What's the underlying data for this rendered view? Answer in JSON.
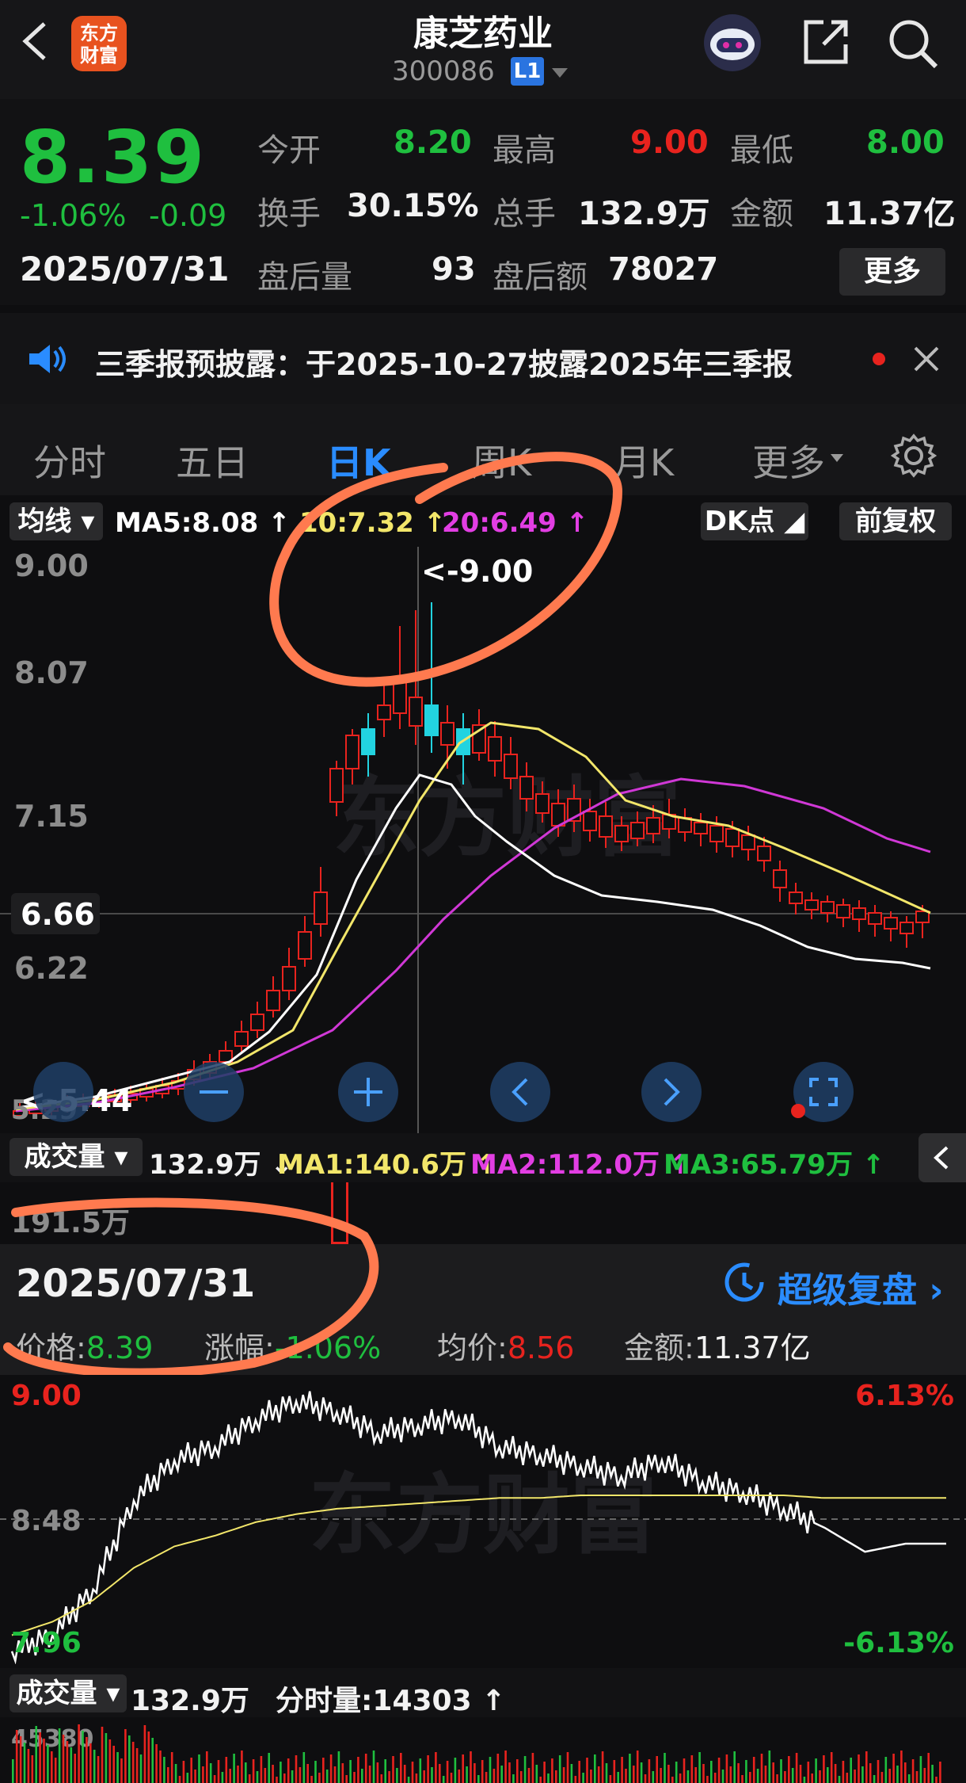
{
  "header": {
    "title": "康芝药业",
    "code": "300086",
    "level_badge": "L1",
    "logo_text": "东方财富",
    "icons": [
      "back-icon",
      "robot-icon",
      "share-icon",
      "search-icon"
    ]
  },
  "quote": {
    "price": "8.39",
    "change_pct": "-1.06%",
    "change": "-0.09",
    "date": "2025/07/31",
    "fields": {
      "open_label": "今开",
      "open": "8.20",
      "high_label": "最高",
      "high": "9.00",
      "low_label": "最低",
      "low": "8.00",
      "turnover_label": "换手",
      "turnover": "30.15%",
      "volume_label": "总手",
      "volume": "132.9万",
      "amount_label": "金额",
      "amount": "11.37亿",
      "after_vol_label": "盘后量",
      "after_vol": "93",
      "after_amt_label": "盘后额",
      "after_amt": "78027"
    },
    "more_button": "更多"
  },
  "notice": {
    "text": "三季报预披露：于2025-10-27披露2025年三季报"
  },
  "tabs": [
    {
      "label": "分时",
      "active": false
    },
    {
      "label": "五日",
      "active": false
    },
    {
      "label": "日K",
      "active": true
    },
    {
      "label": "周K",
      "active": false
    },
    {
      "label": "月K",
      "active": false
    },
    {
      "label": "更多",
      "active": false
    }
  ],
  "kline_bar": {
    "ma_selector": "均线",
    "ma5": "MA5:8.08",
    "ma10": "10:7.32",
    "ma20": "20:6.49",
    "dk_button": "DK点",
    "adjust_button": "前复权",
    "colors": {
      "ma5": "#ffffff",
      "ma10": "#f2e66a",
      "ma20": "#e23ee3",
      "up": "#e8231e",
      "down": "#22d3e0"
    }
  },
  "kline_axis": {
    "labels": [
      "9.00",
      "8.07",
      "7.15",
      "6.66",
      "6.22"
    ],
    "high_marker": "<-9.00",
    "low_marker": "<-5.44",
    "partial_low": "5.29"
  },
  "volume_bar": {
    "selector": "成交量",
    "value": "132.9万",
    "ma1": "MA1:140.6万",
    "ma2": "MA2:112.0万",
    "ma3": "MA3:65.79万",
    "axis_label": "191.5万"
  },
  "day_detail": {
    "date": "2025/07/31",
    "replay_label": "超级复盘",
    "price_label": "价格:",
    "price": "8.39",
    "change_label": "涨幅:",
    "change": "-1.06%",
    "avg_label": "均价:",
    "avg": "8.56",
    "amount_label": "金额:",
    "amount": "11.37亿"
  },
  "intraday": {
    "top_price": "9.00",
    "mid_price": "8.48",
    "bottom_price": "7.96",
    "top_pct": "6.13%",
    "bottom_pct": "-6.13%",
    "volume_selector": "成交量",
    "volume_value": "132.9万",
    "minute_volume": "分时量:14303",
    "vol_axis": "45380"
  },
  "watermark": "东方财富",
  "chart_data": {
    "type": "line",
    "title": "",
    "xlabel": "",
    "ylabel": "",
    "ylim": [
      7.96,
      9.0
    ],
    "series": [
      {
        "values": [
          7.99,
          8.05,
          8.22,
          8.55,
          8.7,
          8.75,
          8.85,
          8.92,
          8.88,
          8.8,
          8.83,
          8.86,
          8.75,
          8.72,
          8.68,
          8.64,
          8.7,
          8.62,
          8.58,
          8.52,
          8.45,
          8.36,
          8.39,
          8.39
        ]
      },
      {
        "values": [
          8.05,
          8.1,
          8.18,
          8.3,
          8.38,
          8.42,
          8.47,
          8.5,
          8.52,
          8.53,
          8.54,
          8.55,
          8.56,
          8.56,
          8.57,
          8.57,
          8.57,
          8.57,
          8.57,
          8.57,
          8.56,
          8.56,
          8.56,
          8.56
        ]
      }
    ]
  }
}
